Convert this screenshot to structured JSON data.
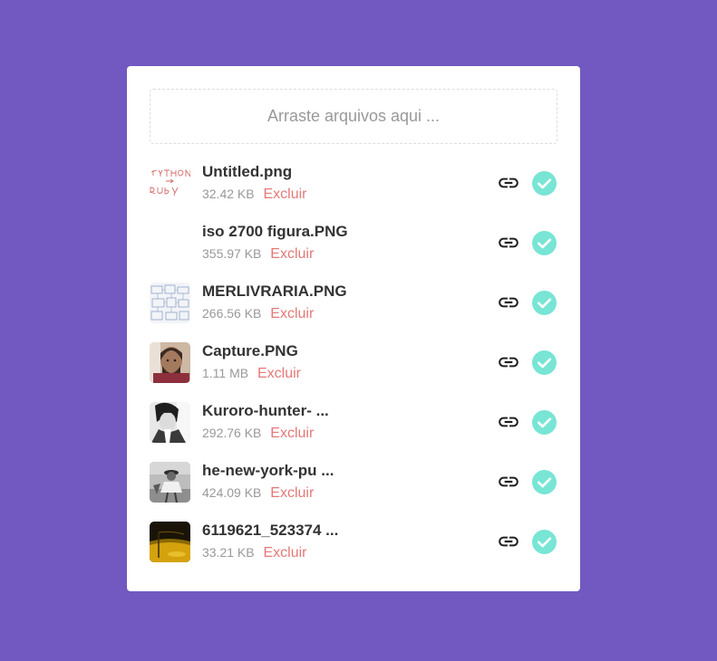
{
  "upload": {
    "dropzone_label": "Arraste arquivos aqui ..."
  },
  "files": [
    {
      "name": "Untitled.png",
      "size": "32.42 KB",
      "delete_label": "Excluir",
      "thumb": "handwriting",
      "status": "success"
    },
    {
      "name": "iso 2700 figura.PNG",
      "size": "355.97 KB",
      "delete_label": "Excluir",
      "thumb": "blank",
      "status": "success"
    },
    {
      "name": "MERLIVRARIA.PNG",
      "size": "266.56 KB",
      "delete_label": "Excluir",
      "thumb": "diagram",
      "status": "success"
    },
    {
      "name": "Capture.PNG",
      "size": "1.11 MB",
      "delete_label": "Excluir",
      "thumb": "portrait",
      "status": "success"
    },
    {
      "name": "Kuroro-hunter- ...",
      "size": "292.76 KB",
      "delete_label": "Excluir",
      "thumb": "anime",
      "status": "success"
    },
    {
      "name": "he-new-york-pu ...",
      "size": "424.09 KB",
      "delete_label": "Excluir",
      "thumb": "photo-bw",
      "status": "success"
    },
    {
      "name": "6119621_523374 ...",
      "size": "33.21 KB",
      "delete_label": "Excluir",
      "thumb": "yellow-scene",
      "status": "success"
    }
  ],
  "icons": {
    "link": "link-icon",
    "success": "check-circle-icon"
  },
  "colors": {
    "background": "#7159c1",
    "card": "#ffffff",
    "delete": "#e57878",
    "success": "#78e5d5",
    "muted": "#999999",
    "text": "#333333"
  }
}
